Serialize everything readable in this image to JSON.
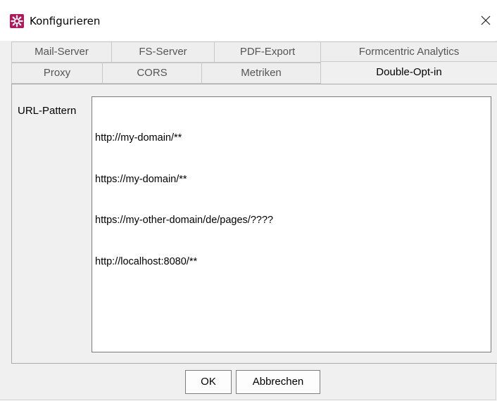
{
  "window": {
    "title": "Konfigurieren",
    "icon": "gear-icon",
    "close_icon": "close-icon"
  },
  "tabs": {
    "row1": [
      "Mail-Server",
      "FS-Server",
      "PDF-Export",
      "Formcentric Analytics"
    ],
    "row2": [
      "Proxy",
      "CORS",
      "Metriken",
      "Double-Opt-in"
    ],
    "active": "Double-Opt-in"
  },
  "panel": {
    "label": "URL-Pattern",
    "url_patterns": [
      "http://my-domain/**",
      "https://my-domain/**",
      "https://my-other-domain/de/pages/????",
      "http://localhost:8080/**"
    ]
  },
  "buttons": {
    "ok": "OK",
    "cancel": "Abbrechen"
  },
  "colors": {
    "icon_background": "#b0195c",
    "dialog_background": "#f0f0f0",
    "tab_inactive_text": "#555555"
  }
}
